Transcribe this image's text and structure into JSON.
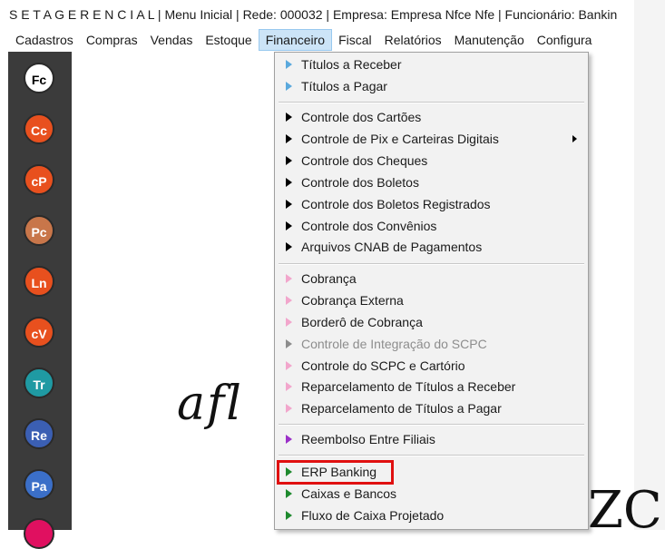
{
  "window": {
    "title": "S E T A  G E R E N C I A L  | Menu Inicial | Rede: 000032 | Empresa: Empresa Nfce Nfe | Funcionário: Bankin"
  },
  "menubar": {
    "items": [
      "Cadastros",
      "Compras",
      "Vendas",
      "Estoque",
      "Financeiro",
      "Fiscal",
      "Relatórios",
      "Manutenção",
      "Configura"
    ],
    "active": "Financeiro"
  },
  "sidebar": {
    "buttons": [
      {
        "label": "Fc",
        "color": "#ffffff",
        "text_color": "#000000"
      },
      {
        "label": "Cc",
        "color": "#e8501e"
      },
      {
        "label": "cP",
        "color": "#e8501e"
      },
      {
        "label": "Pc",
        "color": "#c8764a"
      },
      {
        "label": "Ln",
        "color": "#e8501e"
      },
      {
        "label": "cV",
        "color": "#e8501e"
      },
      {
        "label": "Tr",
        "color": "#1f9aa3"
      },
      {
        "label": "Re",
        "color": "#3b5fb3"
      },
      {
        "label": "Pa",
        "color": "#3b6fc8"
      }
    ]
  },
  "background_text": {
    "left": "afl",
    "right": "ZC"
  },
  "financeiro_menu": {
    "items": [
      {
        "label": "Títulos a Receber",
        "arrow_color": "#5aa9dd",
        "enabled": true
      },
      {
        "label": "Títulos a Pagar",
        "arrow_color": "#5aa9dd",
        "enabled": true
      },
      {
        "label": "Controle dos Cartões",
        "arrow_color": "#000000",
        "enabled": true
      },
      {
        "label": "Controle de Pix e Carteiras Digitais",
        "arrow_color": "#000000",
        "enabled": true,
        "submenu": true
      },
      {
        "label": "Controle dos Cheques",
        "arrow_color": "#000000",
        "enabled": true
      },
      {
        "label": "Controle dos Boletos",
        "arrow_color": "#000000",
        "enabled": true
      },
      {
        "label": "Controle dos Boletos Registrados",
        "arrow_color": "#000000",
        "enabled": true
      },
      {
        "label": "Controle dos Convênios",
        "arrow_color": "#000000",
        "enabled": true
      },
      {
        "label": "Arquivos CNAB de Pagamentos",
        "arrow_color": "#000000",
        "enabled": true
      },
      {
        "label": "Cobrança",
        "arrow_color": "#f2a6cc",
        "enabled": true
      },
      {
        "label": "Cobrança Externa",
        "arrow_color": "#f2a6cc",
        "enabled": true
      },
      {
        "label": "Borderô de Cobrança",
        "arrow_color": "#f2a6cc",
        "enabled": true
      },
      {
        "label": "Controle de Integração do SCPC",
        "arrow_color": "#8d8d8d",
        "enabled": false
      },
      {
        "label": "Controle do SCPC e Cartório",
        "arrow_color": "#f2a6cc",
        "enabled": true
      },
      {
        "label": "Reparcelamento de Títulos a Receber",
        "arrow_color": "#f2a6cc",
        "enabled": true
      },
      {
        "label": "Reparcelamento de Títulos a Pagar",
        "arrow_color": "#f2a6cc",
        "enabled": true
      },
      {
        "label": "Reembolso Entre Filiais",
        "arrow_color": "#9b30c8",
        "enabled": true
      },
      {
        "label": "ERP Banking",
        "arrow_color": "#1e8a2e",
        "enabled": true,
        "highlighted": true
      },
      {
        "label": "Caixas e Bancos",
        "arrow_color": "#1e8a2e",
        "enabled": true
      },
      {
        "label": "Fluxo de Caixa Projetado",
        "arrow_color": "#1e8a2e",
        "enabled": true
      }
    ]
  }
}
